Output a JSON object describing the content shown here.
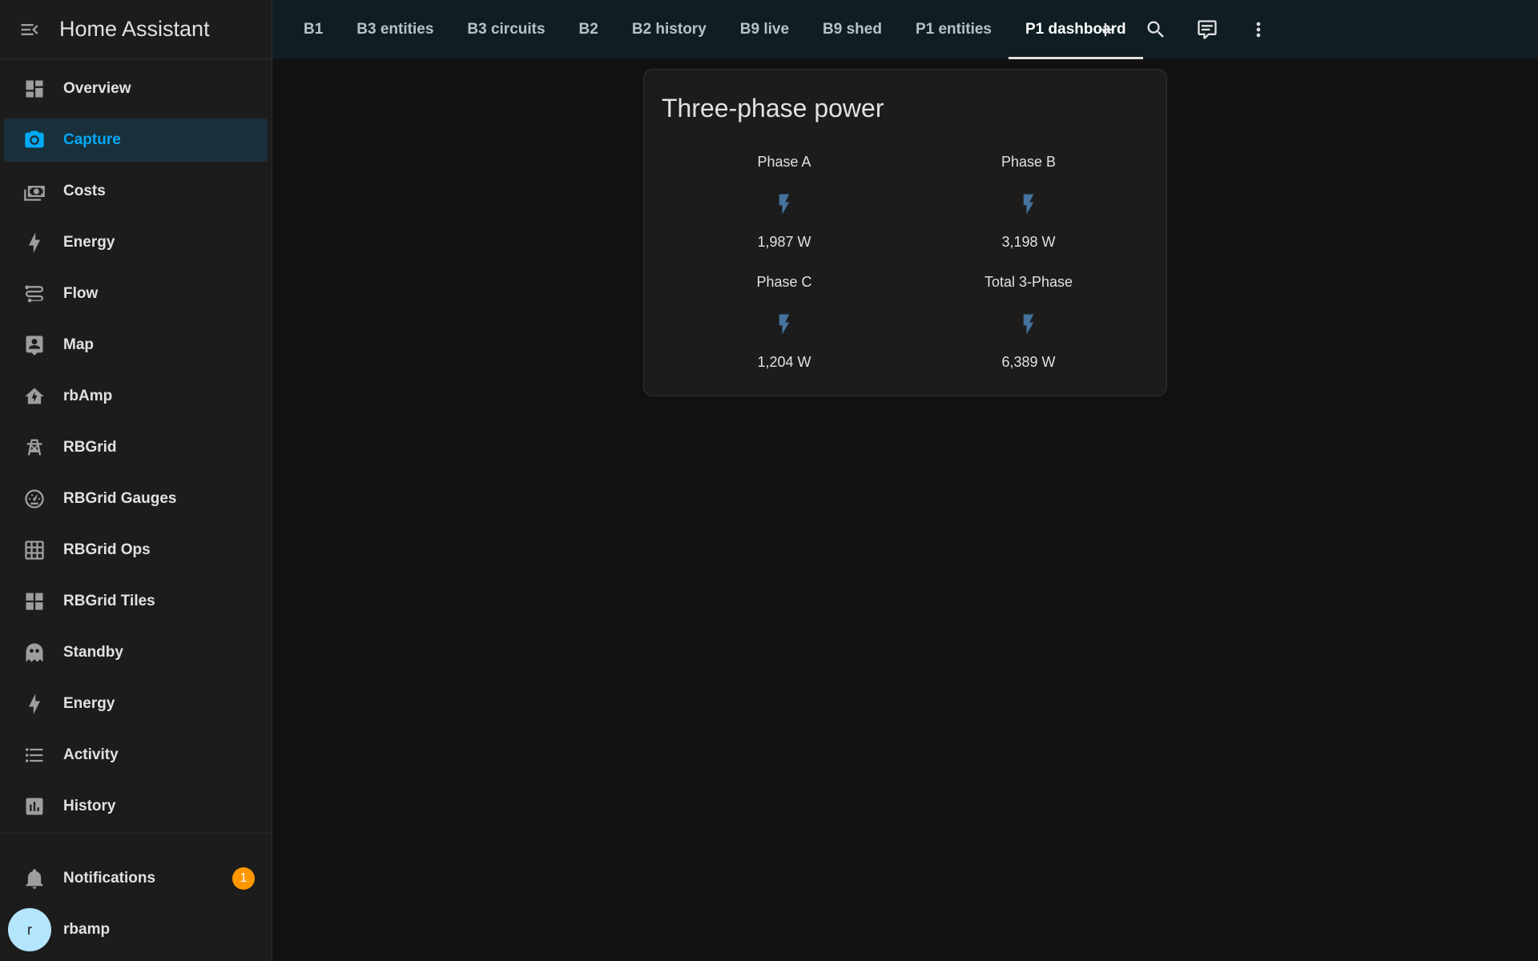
{
  "sidebar": {
    "title": "Home Assistant",
    "items": [
      {
        "label": "Overview",
        "icon": "view-dashboard-icon"
      },
      {
        "label": "Capture",
        "icon": "camera-icon",
        "active": true
      },
      {
        "label": "Costs",
        "icon": "cash-icon"
      },
      {
        "label": "Energy",
        "icon": "lightning-bolt-icon"
      },
      {
        "label": "Flow",
        "icon": "transit-connection-icon"
      },
      {
        "label": "Map",
        "icon": "account-box-icon"
      },
      {
        "label": "rbAmp",
        "icon": "home-lightning-icon"
      },
      {
        "label": "RBGrid",
        "icon": "transmission-tower-icon"
      },
      {
        "label": "RBGrid Gauges",
        "icon": "gauge-icon"
      },
      {
        "label": "RBGrid Ops",
        "icon": "grid-icon"
      },
      {
        "label": "RBGrid Tiles",
        "icon": "view-grid-icon"
      },
      {
        "label": "Standby",
        "icon": "ghost-icon"
      },
      {
        "label": "Energy",
        "icon": "lightning-bolt-icon"
      },
      {
        "label": "Activity",
        "icon": "format-list-bulleted-icon"
      },
      {
        "label": "History",
        "icon": "chart-box-icon"
      }
    ],
    "notifications": {
      "label": "Notifications",
      "count": "1"
    },
    "user": {
      "name": "rbamp",
      "initial": "r"
    }
  },
  "tabs": [
    {
      "label": "B1"
    },
    {
      "label": "B3 entities"
    },
    {
      "label": "B3 circuits"
    },
    {
      "label": "B2"
    },
    {
      "label": "B2 history"
    },
    {
      "label": "B9 live"
    },
    {
      "label": "B9 shed"
    },
    {
      "label": "P1 entities"
    },
    {
      "label": "P1 dashboard",
      "active": true
    }
  ],
  "toolbar": {
    "icons": [
      "plus-icon",
      "search-icon",
      "assist-message-icon",
      "dots-vertical-icon"
    ]
  },
  "card": {
    "title": "Three-phase power",
    "entities": [
      {
        "name": "Phase A",
        "value": "1,987 W",
        "icon": "flash-icon"
      },
      {
        "name": "Phase B",
        "value": "3,198 W",
        "icon": "flash-icon"
      },
      {
        "name": "Phase C",
        "value": "1,204 W",
        "icon": "flash-icon"
      },
      {
        "name": "Total 3-Phase",
        "value": "6,389 W",
        "icon": "flash-icon"
      }
    ],
    "icon_color": "#44739e"
  },
  "colors": {
    "accent": "#03a9f4",
    "badge": "#ff9800",
    "background": "#111111",
    "sidebar": "#1c1c1c",
    "header": "#101e24"
  }
}
